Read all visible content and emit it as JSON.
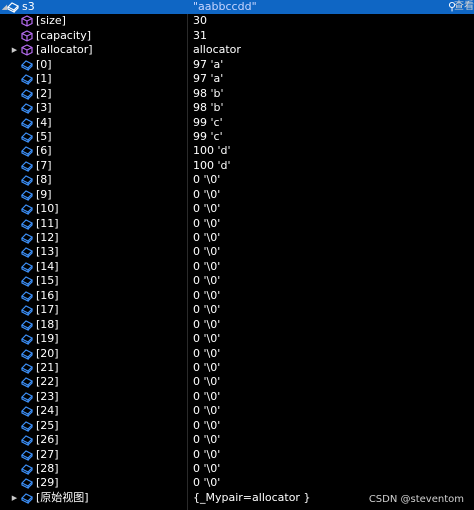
{
  "rows": [
    {
      "name": "s3",
      "value": "\"aabbccdd\"",
      "level": 0,
      "icon": "watch-variable-icon",
      "expander": "expanded",
      "selected": true
    },
    {
      "name": "[size]",
      "value": "30",
      "level": 1,
      "icon": "member-cube-icon"
    },
    {
      "name": "[capacity]",
      "value": "31",
      "level": 1,
      "icon": "member-cube-icon"
    },
    {
      "name": "[allocator]",
      "value": "allocator",
      "level": 1,
      "icon": "member-cube-icon",
      "expander": "collapsed"
    },
    {
      "name": "[0]",
      "value": "97 'a'",
      "level": 1,
      "icon": "field-icon"
    },
    {
      "name": "[1]",
      "value": "97 'a'",
      "level": 1,
      "icon": "field-icon"
    },
    {
      "name": "[2]",
      "value": "98 'b'",
      "level": 1,
      "icon": "field-icon"
    },
    {
      "name": "[3]",
      "value": "98 'b'",
      "level": 1,
      "icon": "field-icon"
    },
    {
      "name": "[4]",
      "value": "99 'c'",
      "level": 1,
      "icon": "field-icon"
    },
    {
      "name": "[5]",
      "value": "99 'c'",
      "level": 1,
      "icon": "field-icon"
    },
    {
      "name": "[6]",
      "value": "100 'd'",
      "level": 1,
      "icon": "field-icon"
    },
    {
      "name": "[7]",
      "value": "100 'd'",
      "level": 1,
      "icon": "field-icon"
    },
    {
      "name": "[8]",
      "value": "0 '\\0'",
      "level": 1,
      "icon": "field-icon"
    },
    {
      "name": "[9]",
      "value": "0 '\\0'",
      "level": 1,
      "icon": "field-icon"
    },
    {
      "name": "[10]",
      "value": "0 '\\0'",
      "level": 1,
      "icon": "field-icon"
    },
    {
      "name": "[11]",
      "value": "0 '\\0'",
      "level": 1,
      "icon": "field-icon"
    },
    {
      "name": "[12]",
      "value": "0 '\\0'",
      "level": 1,
      "icon": "field-icon"
    },
    {
      "name": "[13]",
      "value": "0 '\\0'",
      "level": 1,
      "icon": "field-icon"
    },
    {
      "name": "[14]",
      "value": "0 '\\0'",
      "level": 1,
      "icon": "field-icon"
    },
    {
      "name": "[15]",
      "value": "0 '\\0'",
      "level": 1,
      "icon": "field-icon"
    },
    {
      "name": "[16]",
      "value": "0 '\\0'",
      "level": 1,
      "icon": "field-icon"
    },
    {
      "name": "[17]",
      "value": "0 '\\0'",
      "level": 1,
      "icon": "field-icon"
    },
    {
      "name": "[18]",
      "value": "0 '\\0'",
      "level": 1,
      "icon": "field-icon"
    },
    {
      "name": "[19]",
      "value": "0 '\\0'",
      "level": 1,
      "icon": "field-icon"
    },
    {
      "name": "[20]",
      "value": "0 '\\0'",
      "level": 1,
      "icon": "field-icon"
    },
    {
      "name": "[21]",
      "value": "0 '\\0'",
      "level": 1,
      "icon": "field-icon"
    },
    {
      "name": "[22]",
      "value": "0 '\\0'",
      "level": 1,
      "icon": "field-icon"
    },
    {
      "name": "[23]",
      "value": "0 '\\0'",
      "level": 1,
      "icon": "field-icon"
    },
    {
      "name": "[24]",
      "value": "0 '\\0'",
      "level": 1,
      "icon": "field-icon"
    },
    {
      "name": "[25]",
      "value": "0 '\\0'",
      "level": 1,
      "icon": "field-icon"
    },
    {
      "name": "[26]",
      "value": "0 '\\0'",
      "level": 1,
      "icon": "field-icon"
    },
    {
      "name": "[27]",
      "value": "0 '\\0'",
      "level": 1,
      "icon": "field-icon"
    },
    {
      "name": "[28]",
      "value": "0 '\\0'",
      "level": 1,
      "icon": "field-icon"
    },
    {
      "name": "[29]",
      "value": "0 '\\0'",
      "level": 1,
      "icon": "field-icon"
    },
    {
      "name": "[原始视图]",
      "value": "{_Mypair=allocator }",
      "level": 1,
      "icon": "field-icon",
      "expander": "collapsed"
    }
  ],
  "header_side_text": "查看",
  "watermark": "CSDN @steventom",
  "colors": {
    "background": "#000000",
    "selection": "#0f66c4",
    "cube_icon": "#b56cf0",
    "field_icon": "#3c8ff7",
    "text": "#ffffff"
  }
}
